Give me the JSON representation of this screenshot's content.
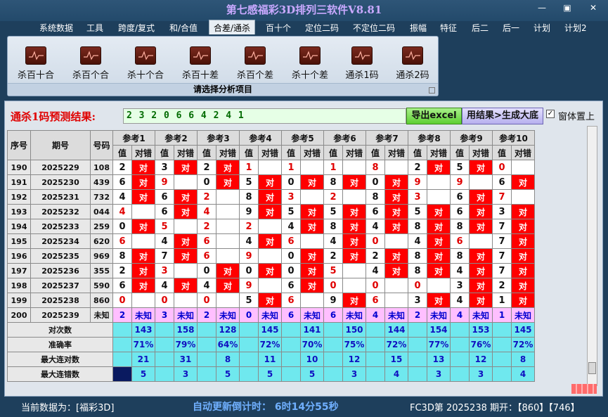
{
  "app": {
    "title": "第七感福彩3D排列三软件V8.81",
    "win_minimize": "—",
    "win_maximize": "▣",
    "win_close": "✕"
  },
  "menu": [
    {
      "label": "系统数据",
      "active": false
    },
    {
      "label": "工具",
      "active": false
    },
    {
      "label": "跨度/复式",
      "active": false
    },
    {
      "label": "和/合值",
      "active": false
    },
    {
      "label": "合差/通杀",
      "active": true
    },
    {
      "label": "百十个",
      "active": false
    },
    {
      "label": "定位二码",
      "active": false
    },
    {
      "label": "不定位二码",
      "active": false
    },
    {
      "label": "振幅",
      "active": false
    },
    {
      "label": "特征",
      "active": false
    },
    {
      "label": "后二",
      "active": false
    },
    {
      "label": "后一",
      "active": false
    },
    {
      "label": "计划",
      "active": false
    },
    {
      "label": "计划2",
      "active": false
    }
  ],
  "ribbon": {
    "buttons": [
      "杀百十合",
      "杀百个合",
      "杀十个合",
      "杀百十差",
      "杀百个差",
      "杀十个差",
      "通杀1码",
      "通杀2码"
    ],
    "footer": "请选择分析项目",
    "icon": "chart-icon"
  },
  "prediction": {
    "label": "通杀1码预测结果:",
    "value": "2 3 2 0 6 6 4 2 4 1",
    "export_label": "导出excel",
    "generate_label": "用结果>生成大底",
    "pin_label": "窗体置上",
    "pin_checked": true
  },
  "table": {
    "headers": {
      "seq": "序号",
      "period": "期号",
      "number": "号码",
      "val": "值",
      "hit": "对错"
    },
    "refs": [
      "参考1",
      "参考2",
      "参考3",
      "参考4",
      "参考5",
      "参考6",
      "参考7",
      "参考8",
      "参考9",
      "参考10"
    ],
    "hit_mark": "对",
    "rows": [
      {
        "seq": "190",
        "period": "2025229",
        "number": "108",
        "vals": [
          "2",
          "3",
          "2",
          "1",
          "1",
          "1",
          "8",
          "2",
          "5",
          "0"
        ],
        "hits": [
          1,
          1,
          1,
          0,
          0,
          0,
          0,
          1,
          1,
          0
        ],
        "redv": [
          0,
          0,
          0,
          1,
          1,
          1,
          1,
          0,
          0,
          1
        ]
      },
      {
        "seq": "191",
        "period": "2025230",
        "number": "439",
        "vals": [
          "6",
          "9",
          "0",
          "5",
          "0",
          "8",
          "0",
          "9",
          "9",
          "6"
        ],
        "hits": [
          1,
          0,
          1,
          1,
          1,
          1,
          1,
          0,
          0,
          1
        ],
        "redv": [
          0,
          1,
          0,
          0,
          0,
          0,
          0,
          1,
          1,
          0
        ]
      },
      {
        "seq": "192",
        "period": "2025231",
        "number": "732",
        "vals": [
          "4",
          "6",
          "2",
          "8",
          "3",
          "2",
          "8",
          "3",
          "6",
          "7"
        ],
        "hits": [
          1,
          1,
          0,
          1,
          0,
          0,
          1,
          0,
          1,
          0
        ],
        "redv": [
          0,
          0,
          1,
          0,
          1,
          1,
          0,
          1,
          0,
          1
        ]
      },
      {
        "seq": "193",
        "period": "2025232",
        "number": "044",
        "vals": [
          "4",
          "6",
          "4",
          "9",
          "5",
          "5",
          "6",
          "5",
          "6",
          "3"
        ],
        "hits": [
          0,
          1,
          0,
          1,
          1,
          1,
          1,
          1,
          1,
          1
        ],
        "redv": [
          1,
          0,
          1,
          0,
          0,
          0,
          0,
          0,
          0,
          0
        ]
      },
      {
        "seq": "194",
        "period": "2025233",
        "number": "259",
        "vals": [
          "0",
          "5",
          "2",
          "2",
          "4",
          "8",
          "4",
          "8",
          "8",
          "7"
        ],
        "hits": [
          1,
          0,
          0,
          0,
          1,
          1,
          1,
          1,
          1,
          1
        ],
        "redv": [
          0,
          1,
          1,
          1,
          0,
          0,
          0,
          0,
          0,
          0
        ]
      },
      {
        "seq": "195",
        "period": "2025234",
        "number": "620",
        "vals": [
          "6",
          "4",
          "6",
          "4",
          "6",
          "4",
          "0",
          "4",
          "6",
          "7"
        ],
        "hits": [
          0,
          1,
          0,
          1,
          0,
          1,
          0,
          1,
          0,
          1
        ],
        "redv": [
          1,
          0,
          1,
          0,
          1,
          0,
          1,
          0,
          1,
          0
        ]
      },
      {
        "seq": "196",
        "period": "2025235",
        "number": "969",
        "vals": [
          "8",
          "7",
          "6",
          "9",
          "0",
          "2",
          "2",
          "8",
          "8",
          "7"
        ],
        "hits": [
          1,
          1,
          0,
          0,
          1,
          1,
          1,
          1,
          1,
          1
        ],
        "redv": [
          0,
          0,
          1,
          1,
          0,
          0,
          0,
          0,
          0,
          0
        ]
      },
      {
        "seq": "197",
        "period": "2025236",
        "number": "355",
        "vals": [
          "2",
          "3",
          "0",
          "0",
          "0",
          "5",
          "4",
          "8",
          "4",
          "7"
        ],
        "hits": [
          1,
          0,
          1,
          1,
          1,
          0,
          1,
          1,
          1,
          1
        ],
        "redv": [
          0,
          1,
          0,
          0,
          0,
          1,
          0,
          0,
          0,
          0
        ]
      },
      {
        "seq": "198",
        "period": "2025237",
        "number": "590",
        "vals": [
          "6",
          "4",
          "4",
          "9",
          "6",
          "0",
          "0",
          "0",
          "3",
          "2"
        ],
        "hits": [
          1,
          1,
          1,
          0,
          1,
          0,
          0,
          0,
          1,
          1
        ],
        "redv": [
          0,
          0,
          0,
          1,
          0,
          1,
          1,
          1,
          0,
          0
        ]
      },
      {
        "seq": "199",
        "period": "2025238",
        "number": "860",
        "vals": [
          "0",
          "0",
          "0",
          "5",
          "6",
          "9",
          "6",
          "3",
          "4",
          "1"
        ],
        "hits": [
          0,
          0,
          0,
          1,
          0,
          1,
          0,
          1,
          1,
          1
        ],
        "redv": [
          1,
          1,
          1,
          0,
          1,
          0,
          1,
          0,
          0,
          0
        ]
      }
    ],
    "next_row": {
      "seq": "200",
      "period": "2025239",
      "number": "未知",
      "vals": [
        "2",
        "3",
        "2",
        "0",
        "6",
        "6",
        "4",
        "2",
        "4",
        "1"
      ],
      "unknown": "未知"
    },
    "stats": [
      {
        "label": "对次数",
        "values": [
          "143",
          "158",
          "128",
          "145",
          "141",
          "150",
          "144",
          "154",
          "153",
          "145"
        ]
      },
      {
        "label": "准确率",
        "values": [
          "71%",
          "79%",
          "64%",
          "72%",
          "70%",
          "75%",
          "72%",
          "77%",
          "76%",
          "72%"
        ]
      },
      {
        "label": "最大连对数",
        "values": [
          "21",
          "31",
          "8",
          "11",
          "10",
          "12",
          "15",
          "13",
          "12",
          "8"
        ]
      },
      {
        "label": "最大连错数",
        "values": [
          "5",
          "3",
          "5",
          "5",
          "5",
          "3",
          "4",
          "3",
          "3",
          "4"
        ]
      }
    ]
  },
  "status": {
    "current_data": "当前数据为：[福彩3D]",
    "countdown": "自动更新倒计时： 6时14分55秒",
    "draw_info": "FC3D第 2025238 期开：【860】【746】"
  }
}
